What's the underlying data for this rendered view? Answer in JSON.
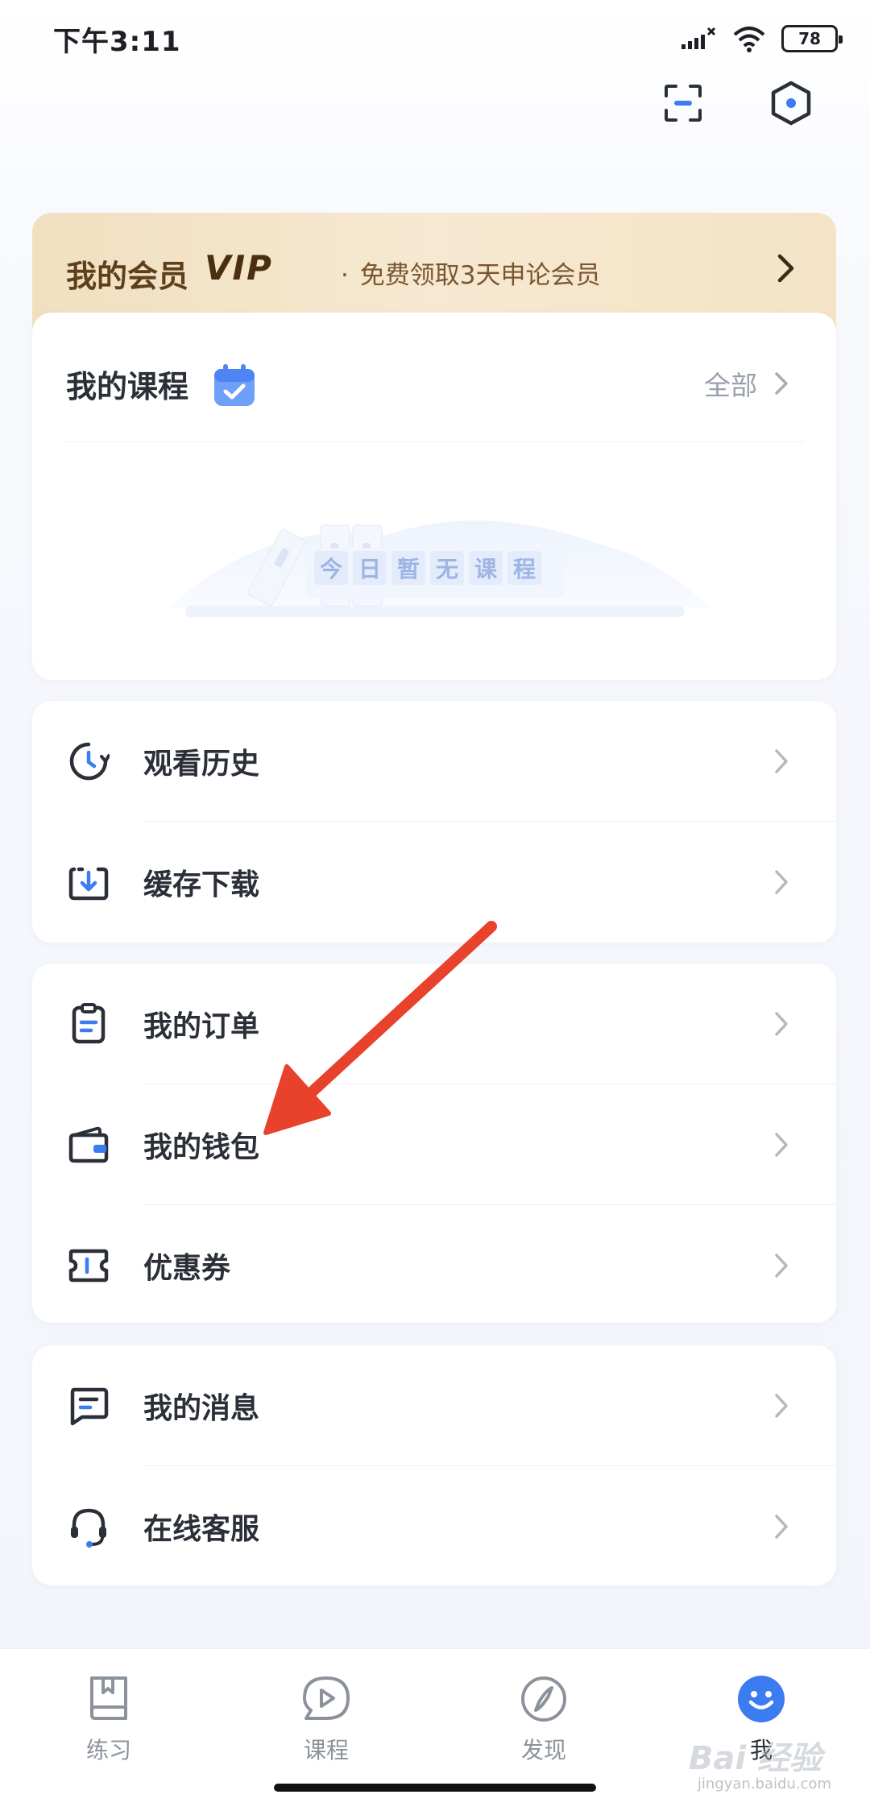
{
  "status_bar": {
    "time": "下午3:11",
    "battery": "78"
  },
  "top_actions": {
    "scan_icon": "scan-icon",
    "settings_icon": "hexagon-settings-icon"
  },
  "vip": {
    "title": "我的会员",
    "badge": "VIP",
    "dot": "·",
    "description": "免费领取3天申论会员"
  },
  "courses": {
    "title": "我的课程",
    "all_label": "全部",
    "empty_chars": [
      "今",
      "日",
      "暂",
      "无",
      "课",
      "程"
    ]
  },
  "menu_groups": {
    "history": [
      {
        "label": "观看历史",
        "icon": "clock-history-icon"
      },
      {
        "label": "缓存下载",
        "icon": "download-icon"
      }
    ],
    "orders": [
      {
        "label": "我的订单",
        "icon": "clipboard-icon"
      },
      {
        "label": "我的钱包",
        "icon": "wallet-icon"
      },
      {
        "label": "优惠券",
        "icon": "ticket-icon"
      }
    ],
    "messages": [
      {
        "label": "我的消息",
        "icon": "message-icon"
      },
      {
        "label": "在线客服",
        "icon": "headset-icon"
      }
    ]
  },
  "bottom_nav": [
    {
      "label": "练习",
      "icon": "book-icon"
    },
    {
      "label": "课程",
      "icon": "play-bubble-icon"
    },
    {
      "label": "发现",
      "icon": "compass-icon"
    },
    {
      "label": "我",
      "icon": "smiley-face-icon",
      "active": true
    }
  ],
  "watermark": {
    "text": "Bai 经验",
    "sub": "jingyan.baidu.com"
  },
  "colors": {
    "accent": "#3b7cf0",
    "annotation_red": "#e8412c",
    "vip_gold": "#f1dfc0"
  }
}
